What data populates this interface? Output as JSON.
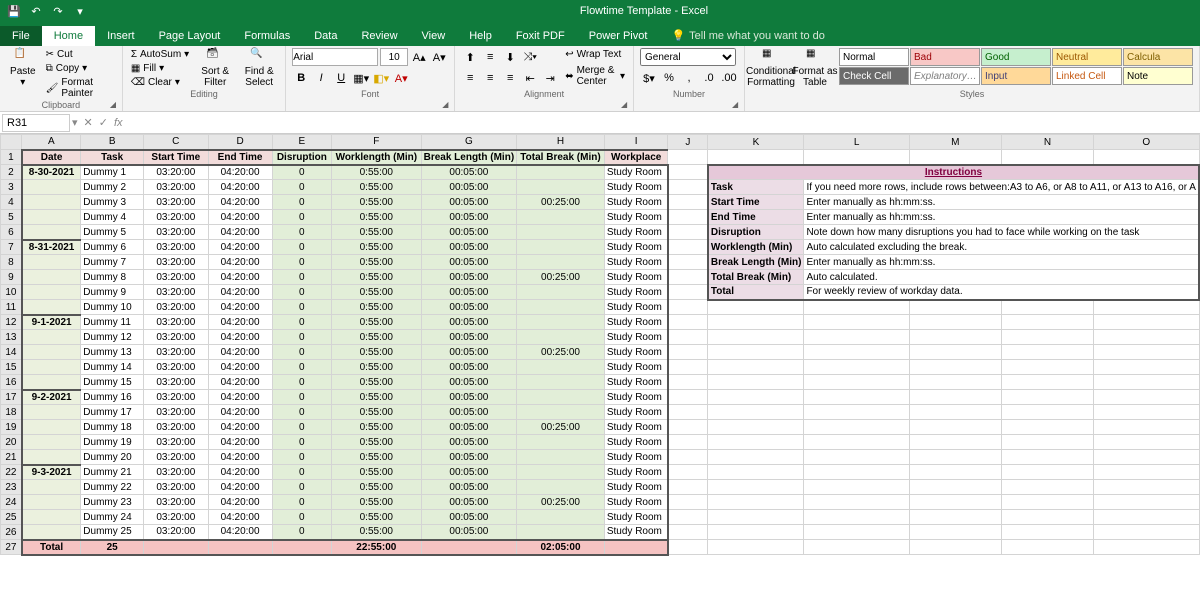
{
  "title": "Flowtime Template  -  Excel",
  "tabs": [
    "File",
    "Home",
    "Insert",
    "Page Layout",
    "Formulas",
    "Data",
    "Review",
    "View",
    "Help",
    "Foxit PDF",
    "Power Pivot"
  ],
  "tellme": "Tell me what you want to do",
  "groups": {
    "clipboard": "Clipboard",
    "font": "Font",
    "alignment": "Alignment",
    "number": "Number",
    "styles": "Styles"
  },
  "clipboard": {
    "paste": "Paste",
    "cut": "Cut",
    "copy": "Copy",
    "painter": "Format Painter"
  },
  "font": {
    "family": "Arial",
    "size": "10"
  },
  "editing": {
    "autosum": "AutoSum",
    "fill": "Fill",
    "clear": "Clear",
    "sortfilter": "Sort &\nFilter",
    "findselect": "Find &\nSelect",
    "label": "Editing"
  },
  "alignment": {
    "wrap": "Wrap Text",
    "merge": "Merge & Center"
  },
  "number": {
    "format": "General"
  },
  "cond": "Conditional\nFormatting",
  "fmt_table": "Format as\nTable",
  "style_cells": [
    {
      "t": "Normal",
      "bg": "#fff",
      "c": "#000"
    },
    {
      "t": "Bad",
      "bg": "#f8c8c6",
      "c": "#9c0006"
    },
    {
      "t": "Good",
      "bg": "#c6efce",
      "c": "#006100"
    },
    {
      "t": "Neutral",
      "bg": "#ffeb9c",
      "c": "#9c5700"
    },
    {
      "t": "Calcula",
      "bg": "#fce4a6",
      "c": "#7f5f00"
    },
    {
      "t": "Check Cell",
      "bg": "#6b6b6b",
      "c": "#fff"
    },
    {
      "t": "Explanatory…",
      "bg": "#fff",
      "c": "#7f7f7f",
      "i": true
    },
    {
      "t": "Input",
      "bg": "#ffd999",
      "c": "#3f3f76"
    },
    {
      "t": "Linked Cell",
      "bg": "#fff",
      "c": "#c65911"
    },
    {
      "t": "Note",
      "bg": "#ffffd1",
      "c": "#000"
    }
  ],
  "namebox": "R31",
  "columns": [
    "A",
    "B",
    "C",
    "D",
    "E",
    "F",
    "G",
    "H",
    "I",
    "J",
    "K",
    "L",
    "M",
    "N",
    "O"
  ],
  "headers": [
    "Date",
    "Task",
    "Start Time",
    "End Time",
    "Disruption",
    "Worklength (Min)",
    "Break Length (Min)",
    "Total Break (Min)",
    "Workplace"
  ],
  "chart_data": {
    "type": "table",
    "columns": [
      "Date",
      "Task",
      "Start Time",
      "End Time",
      "Disruption",
      "Worklength (Min)",
      "Break Length (Min)",
      "Total Break (Min)",
      "Workplace"
    ],
    "rows": [
      [
        "8-30-2021",
        "Dummy 1",
        "03:20:00",
        "04:20:00",
        "0",
        "0:55:00",
        "00:05:00",
        "",
        "Study Room"
      ],
      [
        "",
        "Dummy 2",
        "03:20:00",
        "04:20:00",
        "0",
        "0:55:00",
        "00:05:00",
        "",
        "Study Room"
      ],
      [
        "",
        "Dummy 3",
        "03:20:00",
        "04:20:00",
        "0",
        "0:55:00",
        "00:05:00",
        "00:25:00",
        "Study Room"
      ],
      [
        "",
        "Dummy 4",
        "03:20:00",
        "04:20:00",
        "0",
        "0:55:00",
        "00:05:00",
        "",
        "Study Room"
      ],
      [
        "",
        "Dummy 5",
        "03:20:00",
        "04:20:00",
        "0",
        "0:55:00",
        "00:05:00",
        "",
        "Study Room"
      ],
      [
        "8-31-2021",
        "Dummy 6",
        "03:20:00",
        "04:20:00",
        "0",
        "0:55:00",
        "00:05:00",
        "",
        "Study Room"
      ],
      [
        "",
        "Dummy 7",
        "03:20:00",
        "04:20:00",
        "0",
        "0:55:00",
        "00:05:00",
        "",
        "Study Room"
      ],
      [
        "",
        "Dummy 8",
        "03:20:00",
        "04:20:00",
        "0",
        "0:55:00",
        "00:05:00",
        "00:25:00",
        "Study Room"
      ],
      [
        "",
        "Dummy 9",
        "03:20:00",
        "04:20:00",
        "0",
        "0:55:00",
        "00:05:00",
        "",
        "Study Room"
      ],
      [
        "",
        "Dummy 10",
        "03:20:00",
        "04:20:00",
        "0",
        "0:55:00",
        "00:05:00",
        "",
        "Study Room"
      ],
      [
        "9-1-2021",
        "Dummy 11",
        "03:20:00",
        "04:20:00",
        "0",
        "0:55:00",
        "00:05:00",
        "",
        "Study Room"
      ],
      [
        "",
        "Dummy 12",
        "03:20:00",
        "04:20:00",
        "0",
        "0:55:00",
        "00:05:00",
        "",
        "Study Room"
      ],
      [
        "",
        "Dummy 13",
        "03:20:00",
        "04:20:00",
        "0",
        "0:55:00",
        "00:05:00",
        "00:25:00",
        "Study Room"
      ],
      [
        "",
        "Dummy 14",
        "03:20:00",
        "04:20:00",
        "0",
        "0:55:00",
        "00:05:00",
        "",
        "Study Room"
      ],
      [
        "",
        "Dummy 15",
        "03:20:00",
        "04:20:00",
        "0",
        "0:55:00",
        "00:05:00",
        "",
        "Study Room"
      ],
      [
        "9-2-2021",
        "Dummy 16",
        "03:20:00",
        "04:20:00",
        "0",
        "0:55:00",
        "00:05:00",
        "",
        "Study Room"
      ],
      [
        "",
        "Dummy 17",
        "03:20:00",
        "04:20:00",
        "0",
        "0:55:00",
        "00:05:00",
        "",
        "Study Room"
      ],
      [
        "",
        "Dummy 18",
        "03:20:00",
        "04:20:00",
        "0",
        "0:55:00",
        "00:05:00",
        "00:25:00",
        "Study Room"
      ],
      [
        "",
        "Dummy 19",
        "03:20:00",
        "04:20:00",
        "0",
        "0:55:00",
        "00:05:00",
        "",
        "Study Room"
      ],
      [
        "",
        "Dummy 20",
        "03:20:00",
        "04:20:00",
        "0",
        "0:55:00",
        "00:05:00",
        "",
        "Study Room"
      ],
      [
        "9-3-2021",
        "Dummy 21",
        "03:20:00",
        "04:20:00",
        "0",
        "0:55:00",
        "00:05:00",
        "",
        "Study Room"
      ],
      [
        "",
        "Dummy 22",
        "03:20:00",
        "04:20:00",
        "0",
        "0:55:00",
        "00:05:00",
        "",
        "Study Room"
      ],
      [
        "",
        "Dummy 23",
        "03:20:00",
        "04:20:00",
        "0",
        "0:55:00",
        "00:05:00",
        "00:25:00",
        "Study Room"
      ],
      [
        "",
        "Dummy 24",
        "03:20:00",
        "04:20:00",
        "0",
        "0:55:00",
        "00:05:00",
        "",
        "Study Room"
      ],
      [
        "",
        "Dummy 25",
        "03:20:00",
        "04:20:00",
        "0",
        "0:55:00",
        "00:05:00",
        "",
        "Study Room"
      ]
    ],
    "total": [
      "Total",
      "25",
      "",
      "",
      "",
      "22:55:00",
      "",
      "02:05:00",
      ""
    ]
  },
  "instructions": {
    "title": "Instructions",
    "rows": [
      [
        "Task",
        "If you need more rows, include rows between:A3 to A6, or A8 to A11, or A13 to A16, or A"
      ],
      [
        "Start Time",
        "Enter manually as hh:mm:ss."
      ],
      [
        "End Time",
        "Enter manually as hh:mm:ss."
      ],
      [
        "Disruption",
        "Note down how many disruptions you had to face while working on the task"
      ],
      [
        "Worklength (Min)",
        "Auto calculated excluding the break."
      ],
      [
        "Break Length (Min)",
        "Enter manually as hh:mm:ss."
      ],
      [
        "Total Break (Min)",
        "Auto calculated."
      ],
      [
        "Total",
        "For weekly review of workday data."
      ]
    ]
  }
}
